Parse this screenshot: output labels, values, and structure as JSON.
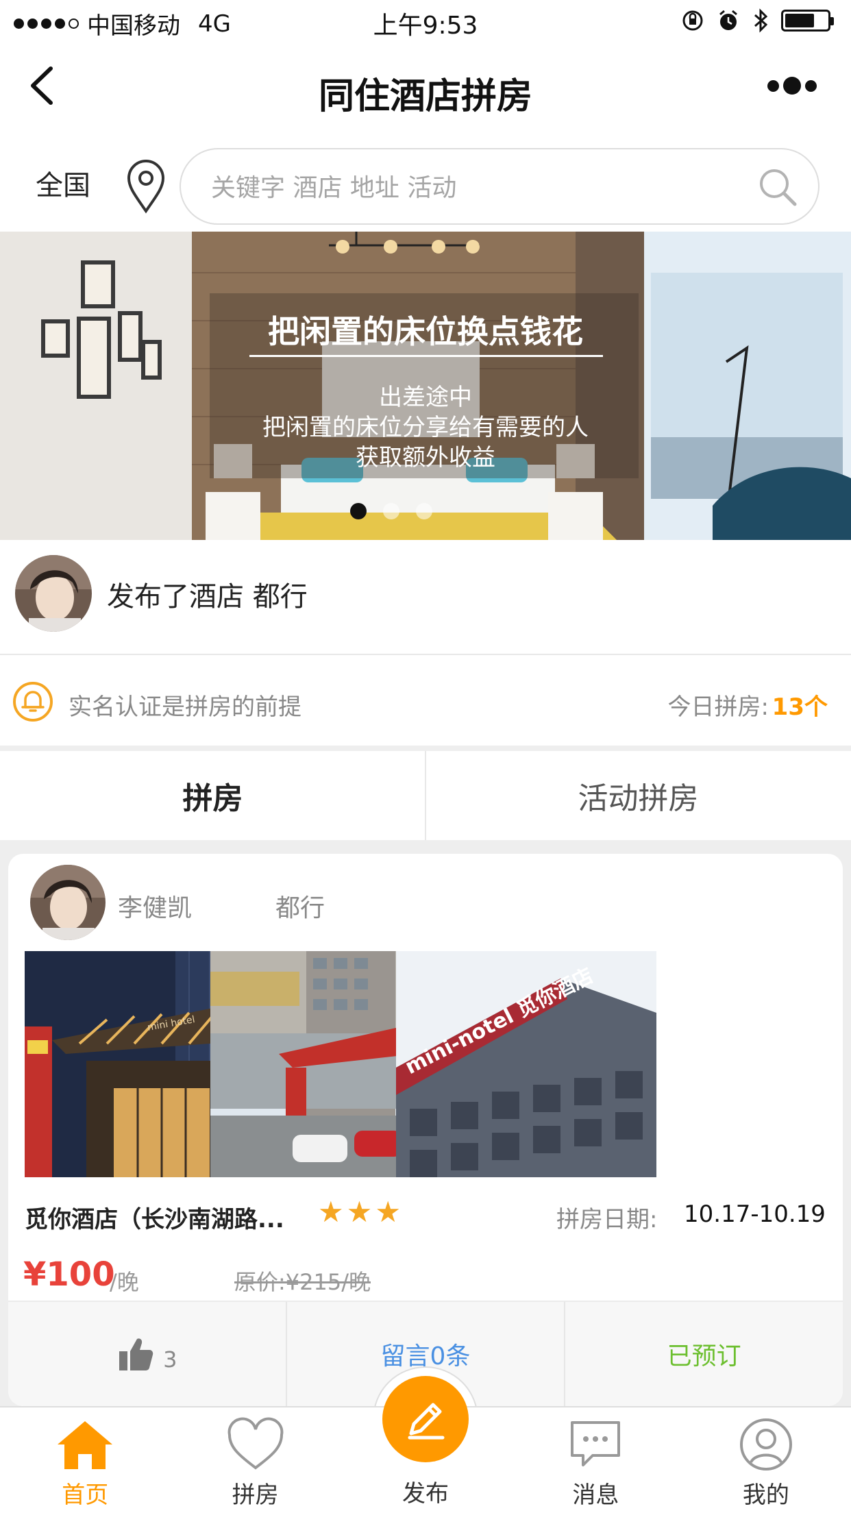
{
  "status_bar": {
    "carrier": "中国移动",
    "network": "4G",
    "time": "上午9:53"
  },
  "nav": {
    "title": "同住酒店拼房"
  },
  "search": {
    "region": "全国",
    "placeholder": "关键字 酒店 地址 活动"
  },
  "banner": {
    "title": "把闲置的床位换点钱花",
    "lines": [
      "出差途中",
      "把闲置的床位分享给有需要的人",
      "获取额外收益"
    ],
    "slide_count": 3,
    "active_slide": 1
  },
  "announcement": {
    "text": "发布了酒店 都行"
  },
  "tip": {
    "text": "实名认证是拼房的前提",
    "today_label": "今日拼房:",
    "today_count": "13个"
  },
  "tabs": [
    {
      "label": "拼房",
      "active": true
    },
    {
      "label": "活动拼房",
      "active": false
    }
  ],
  "listing": {
    "user_name": "李健凯",
    "city": "都行",
    "hotel_name": "觅你酒店（长沙南湖路...",
    "stars": 3,
    "date_label": "拼房日期:",
    "date_value": "10.17-10.19",
    "price": "¥100",
    "price_unit": "/晚",
    "original_price": "原价:¥215/晚",
    "photo_signs": [
      "mini hotel",
      "mini-notel 觅你酒店"
    ],
    "likes": "3",
    "comment_label": "留言0条",
    "status_label": "已预订"
  },
  "tab_bar": {
    "items": [
      {
        "label": "首页",
        "icon": "home-icon",
        "active": true
      },
      {
        "label": "拼房",
        "icon": "heart-icon",
        "active": false
      },
      {
        "label": "发布",
        "icon": "pencil-icon",
        "active": false
      },
      {
        "label": "消息",
        "icon": "message-icon",
        "active": false
      },
      {
        "label": "我的",
        "icon": "profile-icon",
        "active": false
      }
    ]
  },
  "colors": {
    "accent": "#ff9900",
    "price": "#e8423a",
    "comment": "#4a90e2",
    "booked": "#6cbf2f"
  }
}
